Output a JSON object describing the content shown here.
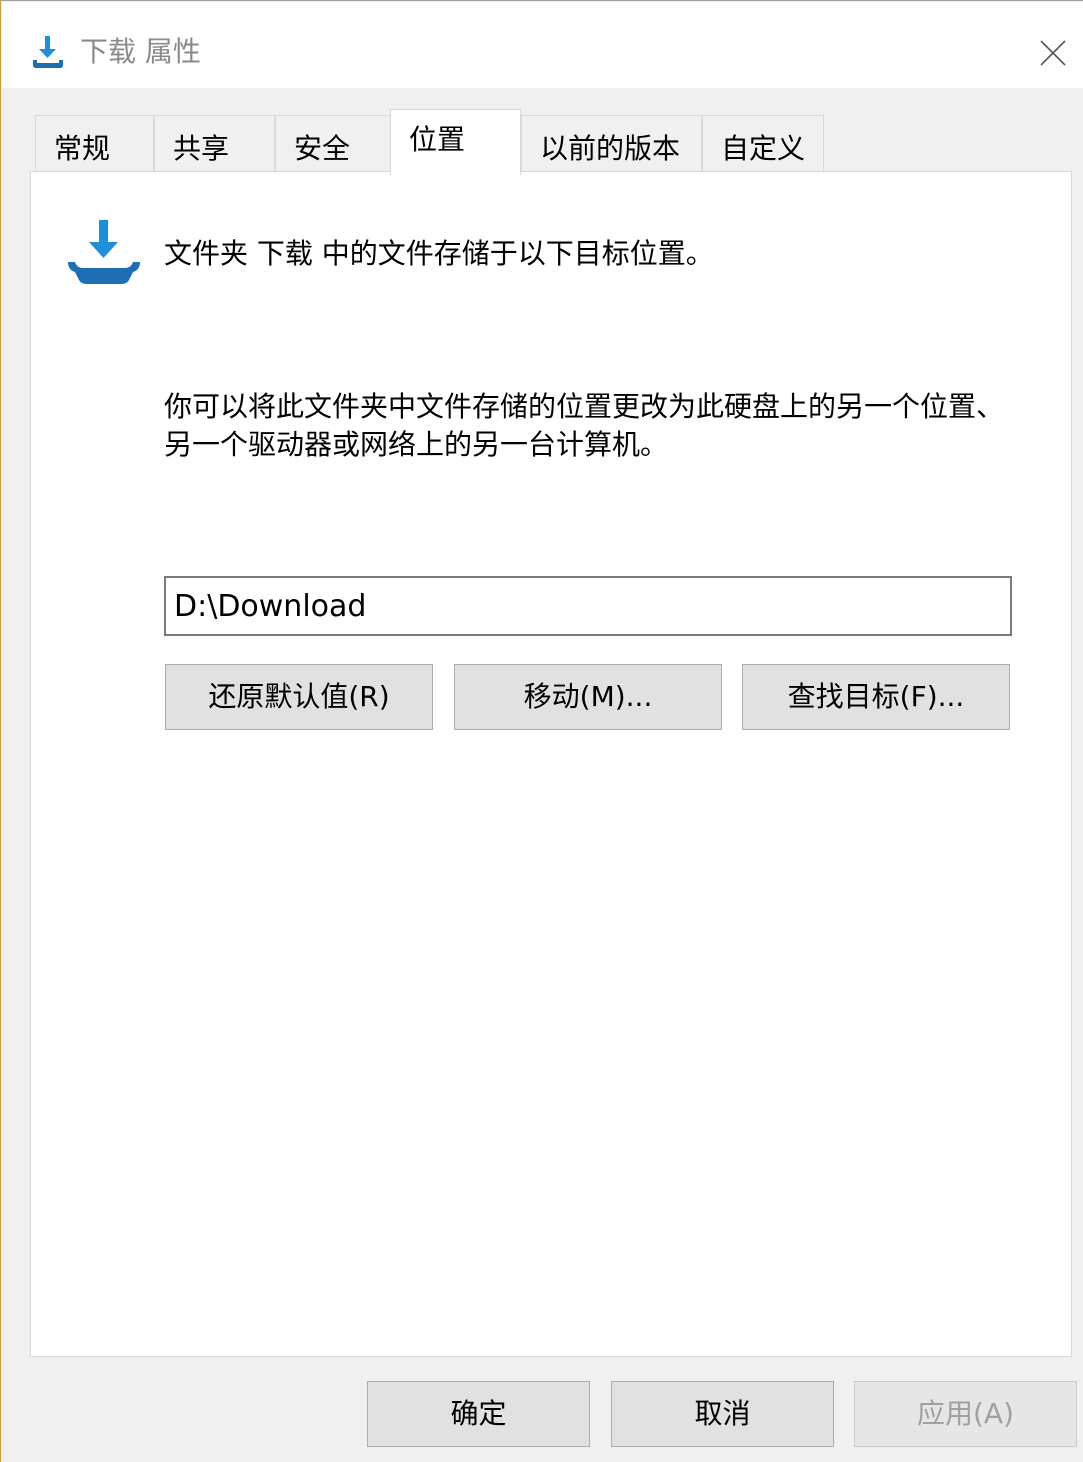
{
  "window": {
    "title": "下载 属性",
    "close_label": "×"
  },
  "tabs": [
    {
      "label": "常规"
    },
    {
      "label": "共享"
    },
    {
      "label": "安全"
    },
    {
      "label": "位置",
      "active": true
    },
    {
      "label": "以前的版本"
    },
    {
      "label": "自定义"
    }
  ],
  "location": {
    "intro": "文件夹 下载 中的文件存储于以下目标位置。",
    "description": "你可以将此文件夹中文件存储的位置更改为此硬盘上的另一个位置、另一个驱动器或网络上的另一台计算机。",
    "path_value": "D:\\Download",
    "restore_label": "还原默认值(R)",
    "move_label": "移动(M)...",
    "find_label": "查找目标(F)..."
  },
  "footer": {
    "ok_label": "确定",
    "cancel_label": "取消",
    "apply_label": "应用(A)"
  },
  "colors": {
    "accent": "#1e8fd8",
    "window_bg": "#f0f0f0",
    "button_bg": "#e1e1e1"
  },
  "icons": {
    "title": "download-icon",
    "folder": "download-folder-icon",
    "close": "close-icon"
  }
}
